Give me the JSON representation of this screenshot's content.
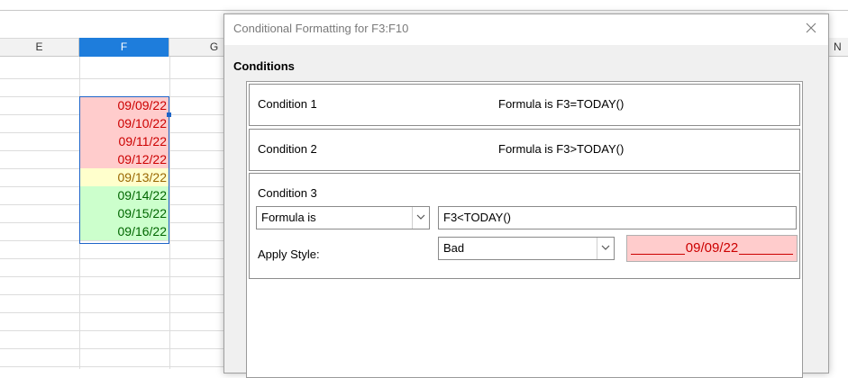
{
  "sheet": {
    "columns": [
      "E",
      "F",
      "G",
      "N"
    ],
    "selected_column": "F",
    "cells": [
      {
        "value": "09/09/22",
        "bg": "#ffcccc",
        "color": "#cc0000"
      },
      {
        "value": "09/10/22",
        "bg": "#ffcccc",
        "color": "#cc0000"
      },
      {
        "value": "09/11/22",
        "bg": "#ffcccc",
        "color": "#cc0000"
      },
      {
        "value": "09/12/22",
        "bg": "#ffcccc",
        "color": "#cc0000"
      },
      {
        "value": "09/13/22",
        "bg": "#ffffcc",
        "color": "#996600"
      },
      {
        "value": "09/14/22",
        "bg": "#ccffcc",
        "color": "#006600"
      },
      {
        "value": "09/15/22",
        "bg": "#ccffcc",
        "color": "#006600"
      },
      {
        "value": "09/16/22",
        "bg": "#ccffcc",
        "color": "#006600"
      }
    ]
  },
  "dialog": {
    "title": "Conditional Formatting for F3:F10",
    "section_label": "Conditions",
    "close_icon": "close-icon",
    "conditions": [
      {
        "name": "Condition 1",
        "summary": "Formula is  F3=TODAY()"
      },
      {
        "name": "Condition 2",
        "summary": "Formula is  F3>TODAY()"
      }
    ],
    "active_condition": {
      "name": "Condition 3",
      "type_select": "Formula is",
      "formula": "F3<TODAY()",
      "apply_style_label": "Apply Style:",
      "style_select": "Bad",
      "preview_text": "09/09/22"
    }
  },
  "colors": {
    "selection_blue": "#1e7ddc",
    "bad_bg": "#ffcccc",
    "bad_text": "#cc0000",
    "neutral_bg": "#ffffcc",
    "neutral_text": "#996600",
    "good_bg": "#ccffcc",
    "good_text": "#006600"
  }
}
